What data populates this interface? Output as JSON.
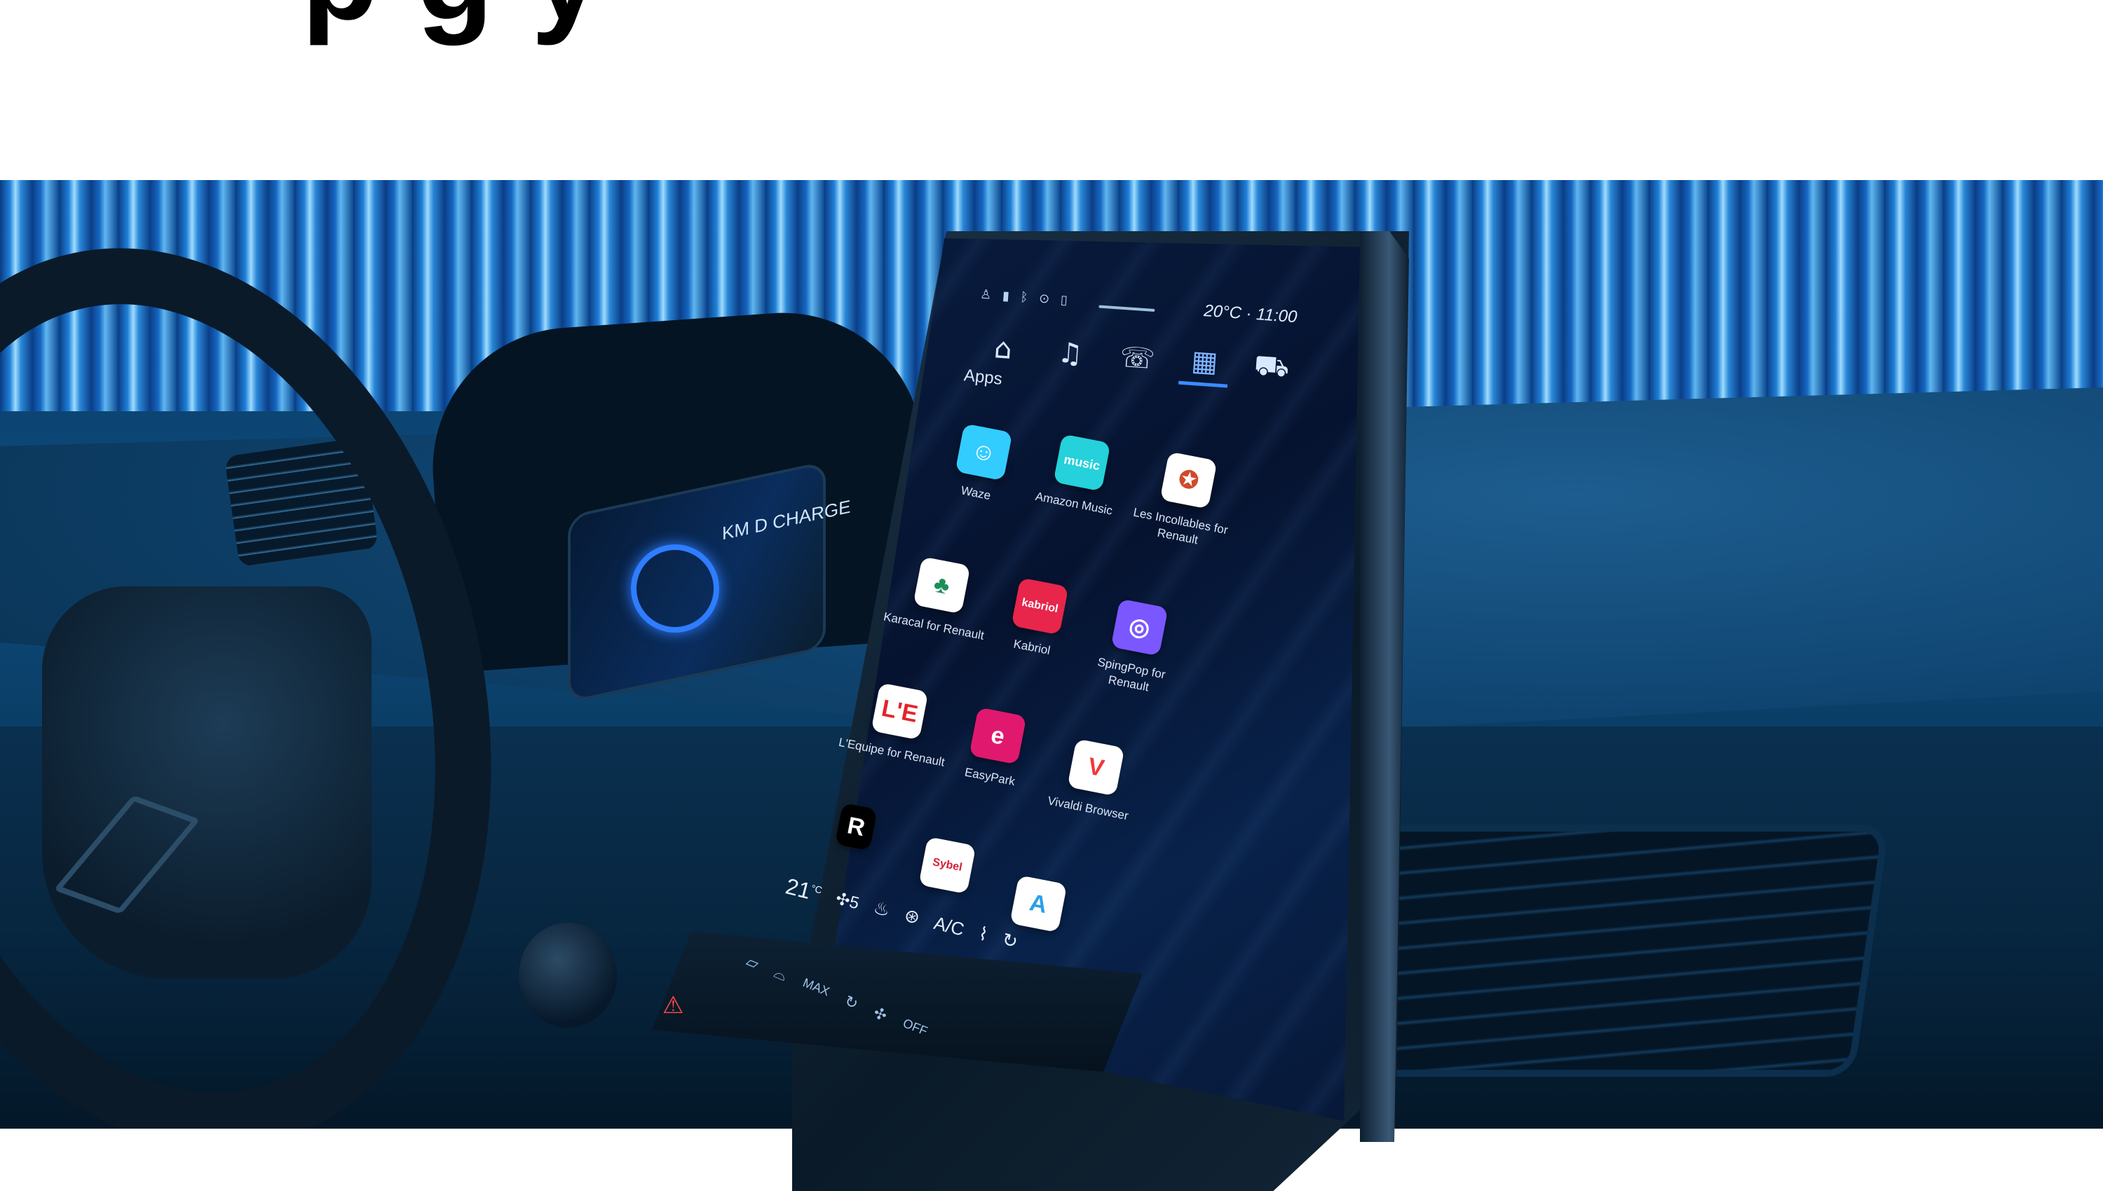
{
  "headline": {
    "text": "p     g  y"
  },
  "infotainment": {
    "status_bar": {
      "icons": [
        "person-icon",
        "signal-icon",
        "bluetooth-icon",
        "location-icon",
        "phone-icon"
      ],
      "temperature": "20°C",
      "separator": "·",
      "time": "11:00"
    },
    "nav_tabs": [
      {
        "id": "home",
        "icon": "home-icon",
        "glyph": "⌂"
      },
      {
        "id": "music",
        "icon": "music-icon",
        "glyph": "♫"
      },
      {
        "id": "phone",
        "icon": "phone-icon",
        "glyph": "☏"
      },
      {
        "id": "apps",
        "icon": "apps-grid-icon",
        "glyph": "▦",
        "active": true
      },
      {
        "id": "vehicle",
        "icon": "car-icon",
        "glyph": "⛟"
      }
    ],
    "section_title": "Apps",
    "apps": [
      {
        "name": "Waze",
        "icon_color": "#33ccff"
      },
      {
        "name": "Amazon Music",
        "icon_color": "#25d1da",
        "icon_text": "music"
      },
      {
        "name": "Les Incollables for Renault",
        "icon_color": "#ffffff"
      },
      {
        "name": "Karacal for Renault",
        "icon_color": "#ffffff"
      },
      {
        "name": "Kabriol",
        "icon_color": "#e8254b",
        "icon_text": "kabriol"
      },
      {
        "name": "SpingPop for Renault",
        "icon_color": "#7a57ff"
      },
      {
        "name": "L'Equipe for Renault",
        "icon_color": "#ffffff",
        "icon_text": "L'E"
      },
      {
        "name": "EasyPark",
        "icon_color": "#e0196f",
        "icon_text": "e"
      },
      {
        "name": "Vivaldi Browser",
        "icon_color": "#ffffff",
        "icon_text": "V"
      },
      {
        "name": "",
        "icon_color": "#000000",
        "icon_text": "R"
      },
      {
        "name": "",
        "icon_color": "#ffffff",
        "icon_text": "Sybel"
      },
      {
        "name": "",
        "icon_color": "#ffffff",
        "icon_text": "A"
      }
    ],
    "climate": {
      "temperature": "21",
      "temperature_unit": "°C",
      "fan": "5",
      "ac_label": "A/C"
    }
  },
  "hard_buttons": {
    "labels": [
      "MAX",
      "OFF"
    ],
    "colors": {
      "hazard": "#ff4a4a"
    }
  },
  "instrument_cluster": {
    "readouts": [
      "KM",
      "D",
      "CHARGE"
    ]
  },
  "colors": {
    "wall_light": "#9fdcff",
    "wall_dark": "#0a3c82",
    "dashboard": "#0f4470",
    "screen_bg": "#061330",
    "accent": "#3d8bff"
  }
}
